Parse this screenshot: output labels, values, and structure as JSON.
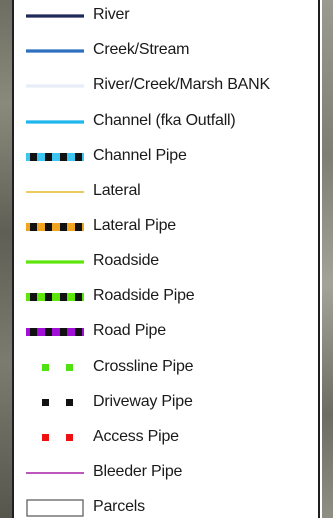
{
  "legend": {
    "items": [
      {
        "label": "River",
        "symbol": "solid-line",
        "color": "#1d2a59",
        "thickness": "thick"
      },
      {
        "label": "Creek/Stream",
        "symbol": "solid-line",
        "color": "#2f6fc0",
        "thickness": "thick"
      },
      {
        "label": "River/Creek/Marsh BANK",
        "symbol": "solid-line",
        "color": "#e8eef7",
        "thickness": "thick"
      },
      {
        "label": "Channel (fka Outfall)",
        "symbol": "solid-line",
        "color": "#1fb6ee",
        "thickness": "thick"
      },
      {
        "label": "Channel Pipe",
        "symbol": "pipe",
        "color": "#3fc6f0",
        "dash_color": "#111111"
      },
      {
        "label": "Lateral",
        "symbol": "solid-line",
        "color": "#e8c24a",
        "thickness": "thin"
      },
      {
        "label": "Lateral Pipe",
        "symbol": "pipe",
        "color": "#f0a522",
        "dash_color": "#111111"
      },
      {
        "label": "Roadside",
        "symbol": "solid-line",
        "color": "#5ee60c",
        "thickness": "thick"
      },
      {
        "label": "Roadside Pipe",
        "symbol": "pipe",
        "color": "#5ee60c",
        "dash_color": "#111111"
      },
      {
        "label": "Road Pipe",
        "symbol": "pipe",
        "color": "#a10fd8",
        "dash_color": "#111111"
      },
      {
        "label": "Crossline Pipe",
        "symbol": "dots",
        "color": "#4fe210"
      },
      {
        "label": "Driveway Pipe",
        "symbol": "dots",
        "color": "#111111"
      },
      {
        "label": "Access Pipe",
        "symbol": "dots",
        "color": "#ee1111"
      },
      {
        "label": "Bleeder Pipe",
        "symbol": "solid-line",
        "color": "#b53fb2",
        "thickness": "thin"
      },
      {
        "label": "Parcels",
        "symbol": "box",
        "color": "#555555"
      }
    ]
  }
}
